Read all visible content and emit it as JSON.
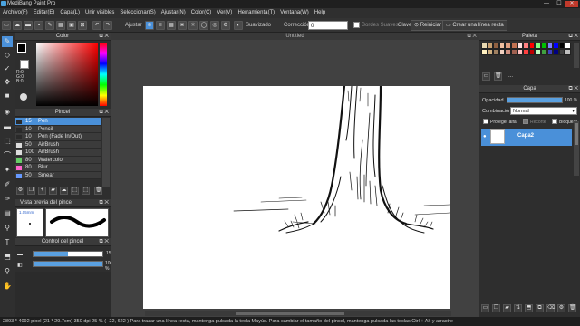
{
  "app": {
    "title": "MediBang Paint Pro"
  },
  "window_controls": {
    "minimize": "—",
    "maximize": "☐",
    "close": "✕"
  },
  "menu": [
    "Archivo(F)",
    "Editar(E)",
    "Capa(L)",
    "Unir visibles",
    "Seleccionar(S)",
    "Ajustar(N)",
    "Color(C)",
    "Ver(V)",
    "Herramienta(T)",
    "Ventana(W)",
    "Help"
  ],
  "toolbar": {
    "ajustar_label": "Ajustar",
    "suavizado_label": "Suavizado",
    "correccion_label": "Corrección",
    "correccion_value": "0",
    "bordes_label": "Bordes Suaves",
    "clave_label": "Clave",
    "reiniciar_label": "Reiniciar",
    "crear_linea_label": "Crear una línea recta"
  },
  "color_panel": {
    "title": "Color",
    "r": "R:0",
    "g": "G:0",
    "b": "B:0"
  },
  "brush_panel": {
    "title": "Pincel",
    "items": [
      {
        "size": "15",
        "name": "Pen",
        "color": "#2a2a2a",
        "selected": true
      },
      {
        "size": "10",
        "name": "Pencil",
        "color": "#2a2a2a",
        "selected": false
      },
      {
        "size": "10",
        "name": "Pen (Fade In/Out)",
        "color": "#2a2a2a",
        "selected": false
      },
      {
        "size": "50",
        "name": "AirBrush",
        "color": "#dddddd",
        "selected": false
      },
      {
        "size": "100",
        "name": "AirBrush",
        "color": "#dddddd",
        "selected": false
      },
      {
        "size": "80",
        "name": "Watercolor",
        "color": "#66cc66",
        "selected": false
      },
      {
        "size": "80",
        "name": "Blur",
        "color": "#ff66cc",
        "selected": false
      },
      {
        "size": "50",
        "name": "Smear",
        "color": "#6699ff",
        "selected": false
      }
    ]
  },
  "preview_panel": {
    "title": "Vista previa del pincel",
    "size_label": "1.05mm"
  },
  "ctrl_panel": {
    "title": "Control del pincel",
    "size_value": "15",
    "opacity_value": "100 %",
    "size_fraction": 0.5,
    "opacity_fraction": 1.0
  },
  "canvas": {
    "title": "Untitled"
  },
  "palette_panel": {
    "title": "Paleta",
    "swatches": [
      "#e8d8b0",
      "#c8a070",
      "#906040",
      "#f0c0a0",
      "#e0a080",
      "#c07050",
      "#ffe0e0",
      "#ff8080",
      "#ff0000",
      "#80ff80",
      "#00c000",
      "#8080ff",
      "#0000ff",
      "#000000",
      "#ffffff",
      "#fff0c0",
      "#d0b080",
      "#a08060",
      "#f0d0c0",
      "#d09080",
      "#a06050",
      "#ffc0c0",
      "#ff4040",
      "#c00000",
      "#c0ffc0",
      "#40a040",
      "#4040c0",
      "#000080",
      "#404040",
      "#c0c0c0"
    ],
    "more": "..."
  },
  "layer_panel": {
    "title": "Capa",
    "opacity_label": "Opacidad",
    "opacity_value": "100 %",
    "opacity_fraction": 1.0,
    "blend_label": "Combinación",
    "blend_value": "Normal",
    "protect_label": "Proteger alfa",
    "clip_label": "Recorte",
    "lock_label": "Bloquear",
    "layers": [
      {
        "name": "Capa2",
        "selected": true
      }
    ]
  },
  "status": {
    "text": "2893 * 4092 pixel   (21 * 29.7cm)   350 dpi   25 %   ( -22, 622 )   Para trazar una línea recta, mantenga pulsada la tecla Mayús. Para cambiar el tamaño del pincel, mantenga pulsada las teclas Ctrl + Alt y arrastre"
  }
}
